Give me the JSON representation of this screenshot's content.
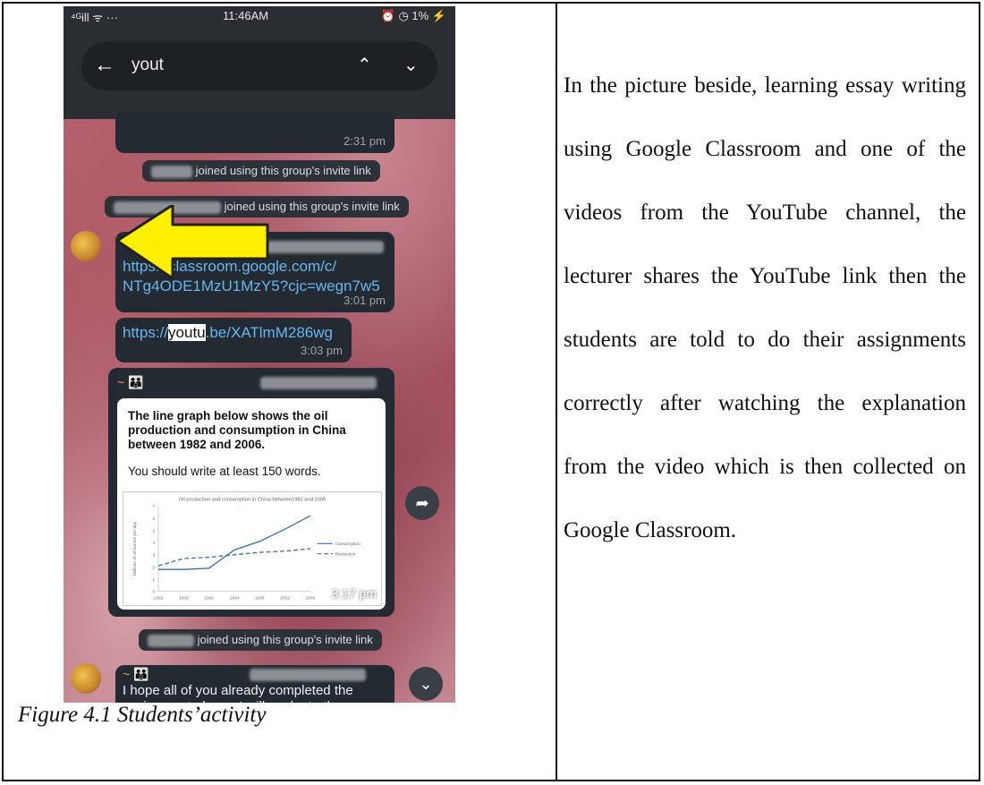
{
  "phone": {
    "status": {
      "signal": "⁴ᴳill ᯤ ···",
      "time": "11:46AM",
      "battery": "⏰ ◷ 1% ⚡"
    },
    "search": {
      "query": "yout"
    },
    "messages": {
      "first_time": "2:31 pm",
      "join1": "joined using this group's invite link",
      "join2": "joined using this group's invite link",
      "classroom_link_1": "https://classroom.google.com/c/",
      "classroom_link_2": "NTg4ODE1MzU1MzY5?cjc=wegn7w5",
      "classroom_time": "3:01 pm",
      "yt_prefix": "https://",
      "yt_highlight": "youtu",
      "yt_suffix": ".be/XATlmM286wg",
      "yt_time": "3:03 pm",
      "card_sender": "~ 👪",
      "card_question": "The line graph below shows the oil production and consumption in China between 1982 and 2006.",
      "card_words": "You should write at least 150 words.",
      "card_time": "3:17 pm",
      "join3": "joined using this group's invite link",
      "last_sender": "~ 👪",
      "last_text": "I hope all of you already completed the assignment above. I will evaluate them"
    }
  },
  "chart_data": {
    "type": "line",
    "title": "Oil production and consumption in China between1982 and 2006",
    "ylabel": "Millions of oil barrels per day",
    "x": [
      1982,
      1986,
      1990,
      1994,
      1998,
      2002,
      2006
    ],
    "ylim": [
      0,
      7
    ],
    "series": [
      {
        "name": "Consumption",
        "values": [
          1.8,
          1.8,
          1.9,
          3.4,
          4.1,
          5.1,
          6.2
        ]
      },
      {
        "name": "Production",
        "values": [
          2.1,
          2.7,
          2.8,
          3.0,
          3.2,
          3.3,
          3.5
        ]
      }
    ]
  },
  "right_text": "In the picture beside, learning essay writing using Google Classroom and one of the videos from the YouTube channel, the lecturer shares the YouTube link then the students are told to do their assignments correctly after watching the explanation from the video which is then collected on Google Classroom.",
  "caption": "Figure 4.1 Students’activity"
}
